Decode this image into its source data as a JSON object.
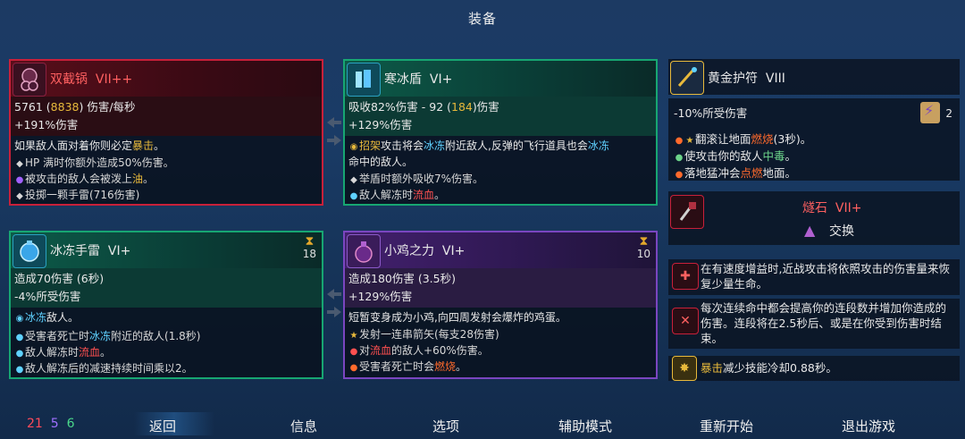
{
  "header": {
    "title": "装备"
  },
  "cards": {
    "c1": {
      "name": "双截锅",
      "level": "VII++",
      "dps": "5761",
      "dps_alt": "8838",
      "dps_suffix": "伤害/每秒",
      "bonus": "+191%伤害",
      "main": "如果敌人面对着你则必定",
      "main_hl": "暴击",
      "main_end": "。",
      "subs": [
        "HP 满时你额外造成50%伤害。",
        "被攻击的敌人会被泼上",
        "油",
        "。",
        "投掷一颗手雷(716伤害)"
      ]
    },
    "c2": {
      "name": "寒冰盾",
      "level": "VI+",
      "stat1": "吸收82%伤害 - 92 (",
      "stat1_hl": "184",
      "stat1_end": ")伤害",
      "bonus": "+129%伤害",
      "main_a": "招架",
      "main_b": "攻击将会",
      "main_c": "冰冻",
      "main_d": "附近敌人,反弹的飞行道具也会",
      "main_e": "冰冻",
      "main_f": "命中的敌人。",
      "sub1": "举盾时额外吸收7%伤害。",
      "sub2a": "敌人解冻时",
      "sub2b": "流血",
      "sub2c": "。"
    },
    "c3": {
      "name": "冰冻手雷",
      "level": "VI+",
      "timer": "18",
      "stat1": "造成70伤害 (6秒)",
      "stat2": "-4%所受伤害",
      "main_a": "冰冻",
      "main_b": "敌人。",
      "sub1a": "受害者死亡时",
      "sub1b": "冰冻",
      "sub1c": "附近的敌人(1.8秒)",
      "sub2a": "敌人解冻时",
      "sub2b": "流血",
      "sub2c": "。",
      "sub3": "敌人解冻后的减速持续时间乘以2。"
    },
    "c4": {
      "name": "小鸡之力",
      "level": "VI+",
      "timer": "10",
      "stat1": "造成180伤害 (3.5秒)",
      "bonus": "+129%伤害",
      "main": "短暂变身成为小鸡,向四周发射会爆炸的鸡蛋。",
      "sub1": "发射一连串箭矢(每支28伤害)",
      "sub2a": "对",
      "sub2b": "流血",
      "sub2c": "的敌人+60%伤害。",
      "sub3a": "受害者死亡时会",
      "sub3b": "燃烧",
      "sub3c": "。"
    }
  },
  "amulet": {
    "name": "黄金护符",
    "level": "VIII",
    "stat": "-10%所受伤害",
    "scroll_count": "2",
    "l1a": "翻滚让地面",
    "l1b": "燃烧",
    "l1c": "(3秒)。",
    "l2a": "使攻击你的敌人",
    "l2b": "中毒",
    "l2c": "。",
    "l3a": "落地猛冲会",
    "l3b": "点燃",
    "l3c": "地面。"
  },
  "rune": {
    "name": "燧石",
    "level": "VII+",
    "swap": "交换"
  },
  "mutations": {
    "m1": "在有速度增益时,近战攻击将依照攻击的伤害量来恢复少量生命。",
    "m2": "每次连续命中都会提高你的连段数并增加你造成的伤害。连段将在2.5秒后、或是在你受到伤害时结束。",
    "m3a": "暴击",
    "m3b": "减少技能冷却0.88秒。"
  },
  "scrolls": {
    "red": "21",
    "purple": "5",
    "green": "6"
  },
  "menu": {
    "back": "返回",
    "info": "信息",
    "options": "选项",
    "assist": "辅助模式",
    "restart": "重新开始",
    "quit": "退出游戏"
  },
  "colors": {
    "brutality": "#c8203a",
    "survival": "#17a672",
    "tactics": "#7a46c0",
    "highlight": "#e8b93b"
  }
}
